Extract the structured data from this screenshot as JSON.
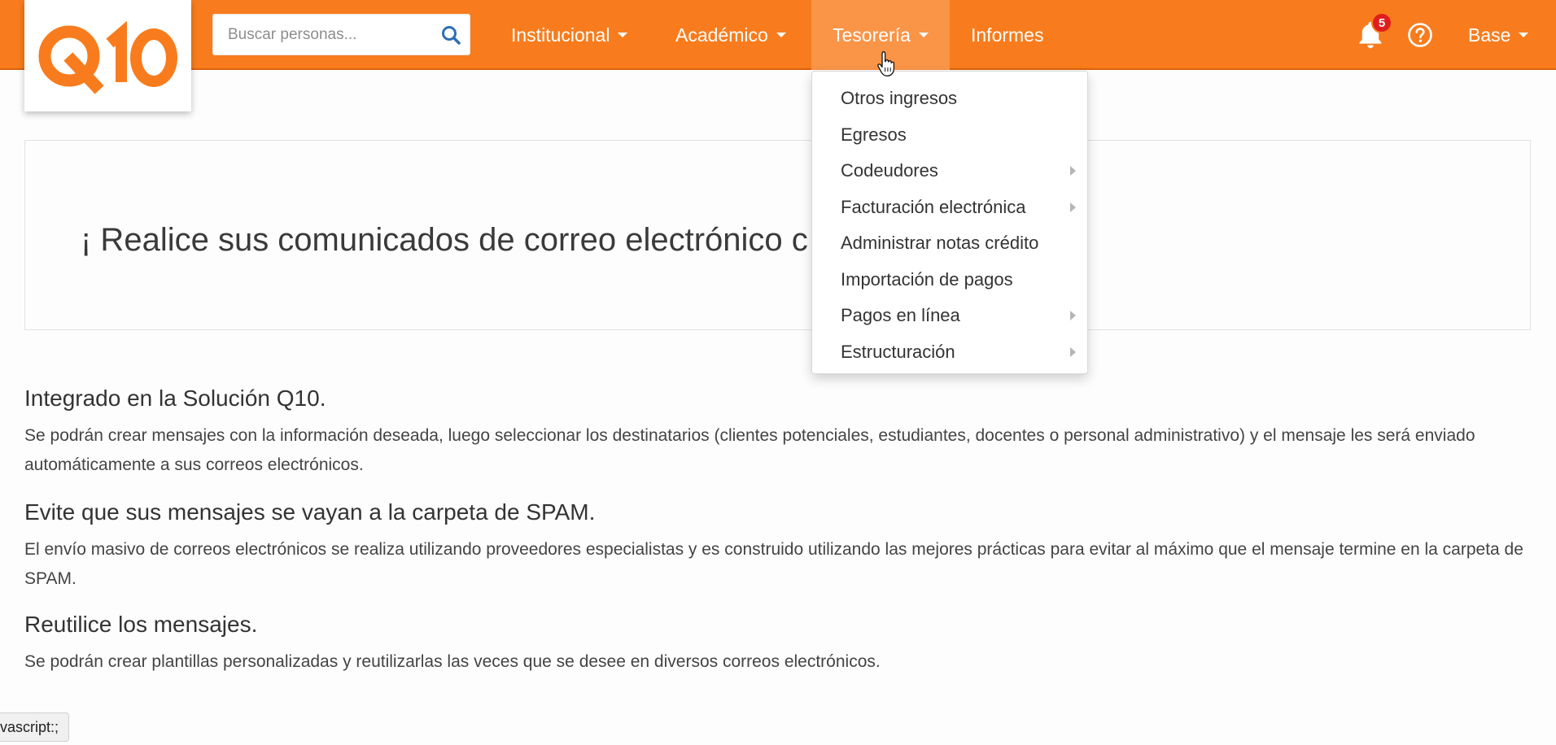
{
  "brand": {
    "logo_text": "Q10",
    "primary_color": "#f87c1d"
  },
  "search": {
    "placeholder": "Buscar personas...",
    "icon": "search-icon"
  },
  "nav": {
    "items": [
      {
        "label": "Institucional",
        "has_caret": true
      },
      {
        "label": "Académico",
        "has_caret": true
      },
      {
        "label": "Tesorería",
        "has_caret": true,
        "active": true
      },
      {
        "label": "Informes",
        "has_caret": false
      }
    ],
    "notifications_count": "5",
    "user_label": "Base"
  },
  "dropdown": {
    "items": [
      {
        "label": "Otros ingresos",
        "submenu": false
      },
      {
        "label": "Egresos",
        "submenu": false
      },
      {
        "label": "Codeudores",
        "submenu": true
      },
      {
        "label": "Facturación electrónica",
        "submenu": true
      },
      {
        "label": "Administrar notas crédito",
        "submenu": false
      },
      {
        "label": "Importación de pagos",
        "submenu": false
      },
      {
        "label": "Pagos en línea",
        "submenu": true
      },
      {
        "label": "Estructuración",
        "submenu": true
      }
    ]
  },
  "banner": {
    "text": "¡ Realice sus comunicados de correo electrónico c"
  },
  "sections": [
    {
      "title": "Integrado en la Solución Q10.",
      "body": "Se podrán crear mensajes con la información deseada, luego seleccionar los destinatarios (clientes potenciales, estudiantes, docentes o personal administrativo) y el mensaje les será enviado automáticamente a sus correos electrónicos."
    },
    {
      "title": "Evite que sus mensajes se vayan a la carpeta de SPAM.",
      "body": "El envío masivo de correos electrónicos se realiza utilizando proveedores especialistas y es construido utilizando las mejores prácticas para evitar al máximo que el mensaje termine en la carpeta de SPAM."
    },
    {
      "title": "Reutilice los mensajes.",
      "body": "Se podrán crear plantillas personalizadas y reutilizarlas las veces que se desee en diversos correos electrónicos."
    }
  ],
  "status_bar": {
    "text": "vascript:;"
  }
}
